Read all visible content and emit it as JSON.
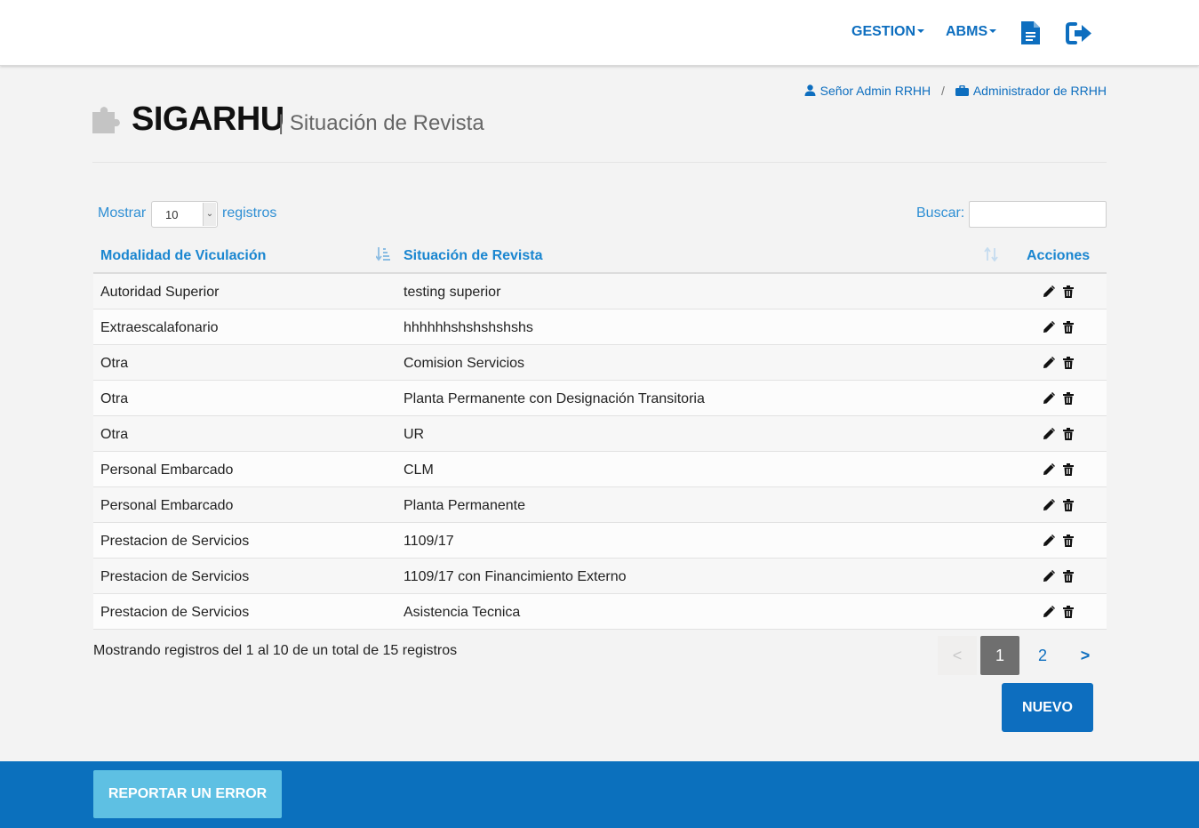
{
  "nav": {
    "gestion_label": "GESTION",
    "abms_label": "ABMS",
    "document_icon": "document-icon",
    "logout_icon": "logout-icon"
  },
  "user": {
    "name": "Señor Admin RRHH",
    "separator": "/",
    "role": "Administrador de RRHH"
  },
  "header": {
    "app_title": "SIGARHU",
    "page_subtitle": "| Situación de Revista"
  },
  "controls": {
    "show_label": "Mostrar",
    "page_size": "10",
    "records_label": "registros",
    "search_label": "Buscar:",
    "search_value": ""
  },
  "table": {
    "columns": [
      "Modalidad de Viculación",
      "Situación de Revista",
      "Acciones"
    ],
    "rows": [
      {
        "modalidad": "Autoridad Superior",
        "situacion": "testing superior"
      },
      {
        "modalidad": "Extraescalafonario",
        "situacion": "hhhhhhshshshshshs"
      },
      {
        "modalidad": "Otra",
        "situacion": "Comision Servicios"
      },
      {
        "modalidad": "Otra",
        "situacion": "Planta Permanente con Designación Transitoria"
      },
      {
        "modalidad": "Otra",
        "situacion": "UR"
      },
      {
        "modalidad": "Personal Embarcado",
        "situacion": "CLM"
      },
      {
        "modalidad": "Personal Embarcado",
        "situacion": "Planta Permanente"
      },
      {
        "modalidad": "Prestacion de Servicios",
        "situacion": "1109/17"
      },
      {
        "modalidad": "Prestacion de Servicios",
        "situacion": "1109/17 con Financimiento Externo"
      },
      {
        "modalidad": "Prestacion de Servicios",
        "situacion": "Asistencia Tecnica"
      }
    ]
  },
  "footer": {
    "info": "Mostrando registros del 1 al 10 de un total de 15 registros",
    "pagination": {
      "prev": "<",
      "pages": [
        "1",
        "2"
      ],
      "current": "1",
      "next": ">"
    },
    "new_button": "NUEVO",
    "report_button": "REPORTAR UN ERROR"
  },
  "colors": {
    "primary": "#0d6ebf",
    "link": "#1a86d0",
    "footer_bg": "#0b70bd",
    "report_btn": "#5ec0e3",
    "page_active": "#6f6f6f"
  }
}
